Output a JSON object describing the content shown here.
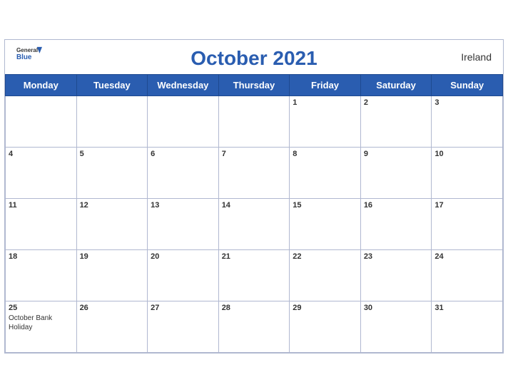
{
  "header": {
    "logo_general": "General",
    "logo_blue": "Blue",
    "month_title": "October 2021",
    "country": "Ireland"
  },
  "weekdays": [
    "Monday",
    "Tuesday",
    "Wednesday",
    "Thursday",
    "Friday",
    "Saturday",
    "Sunday"
  ],
  "weeks": [
    [
      {
        "day": "",
        "events": []
      },
      {
        "day": "",
        "events": []
      },
      {
        "day": "",
        "events": []
      },
      {
        "day": "",
        "events": []
      },
      {
        "day": "1",
        "events": []
      },
      {
        "day": "2",
        "events": []
      },
      {
        "day": "3",
        "events": []
      }
    ],
    [
      {
        "day": "4",
        "events": []
      },
      {
        "day": "5",
        "events": []
      },
      {
        "day": "6",
        "events": []
      },
      {
        "day": "7",
        "events": []
      },
      {
        "day": "8",
        "events": []
      },
      {
        "day": "9",
        "events": []
      },
      {
        "day": "10",
        "events": []
      }
    ],
    [
      {
        "day": "11",
        "events": []
      },
      {
        "day": "12",
        "events": []
      },
      {
        "day": "13",
        "events": []
      },
      {
        "day": "14",
        "events": []
      },
      {
        "day": "15",
        "events": []
      },
      {
        "day": "16",
        "events": []
      },
      {
        "day": "17",
        "events": []
      }
    ],
    [
      {
        "day": "18",
        "events": []
      },
      {
        "day": "19",
        "events": []
      },
      {
        "day": "20",
        "events": []
      },
      {
        "day": "21",
        "events": []
      },
      {
        "day": "22",
        "events": []
      },
      {
        "day": "23",
        "events": []
      },
      {
        "day": "24",
        "events": []
      }
    ],
    [
      {
        "day": "25",
        "events": [
          "October Bank Holiday"
        ]
      },
      {
        "day": "26",
        "events": []
      },
      {
        "day": "27",
        "events": []
      },
      {
        "day": "28",
        "events": []
      },
      {
        "day": "29",
        "events": []
      },
      {
        "day": "30",
        "events": []
      },
      {
        "day": "31",
        "events": []
      }
    ]
  ]
}
